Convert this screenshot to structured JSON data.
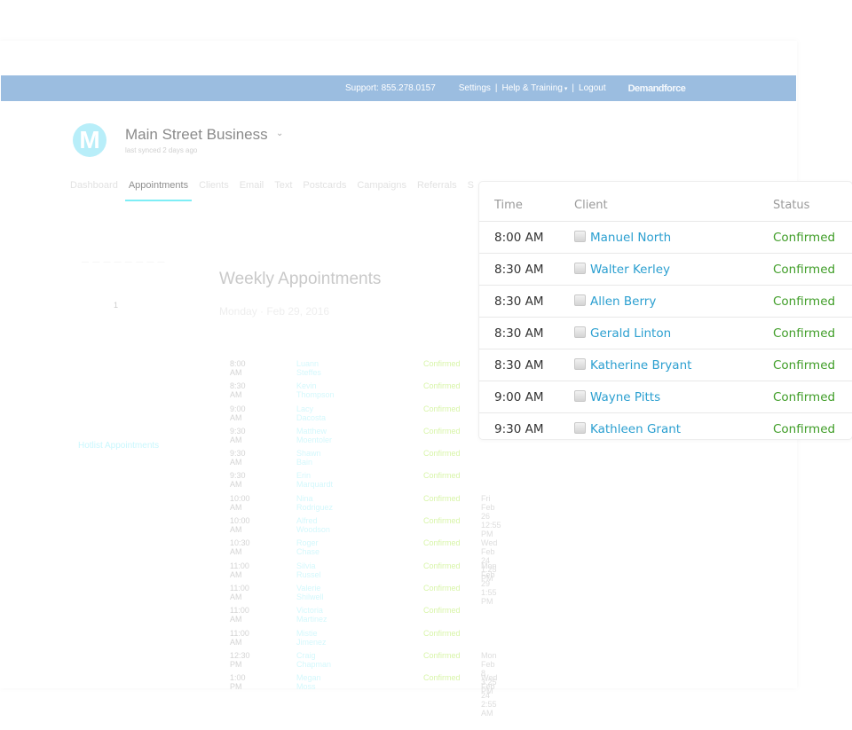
{
  "topbar": {
    "support": "Support:  855.278.0157",
    "settings": "Settings",
    "help": "Help & Training",
    "logout": "Logout",
    "brand": "Demandforce",
    "separator": "|",
    "caret": "▾",
    "color": "#9bbde0"
  },
  "business": {
    "logo_letter": "M",
    "name": "Main Street Business",
    "caret": "⌄",
    "synced": "last synced 2 days ago"
  },
  "nav": {
    "items": [
      "Dashboard",
      "Appointments",
      "Clients",
      "Email",
      "Text",
      "Postcards",
      "Campaigns",
      "Referrals",
      "S"
    ],
    "active": "Appointments"
  },
  "sidebar": {
    "label": "— — — — — — — —",
    "count": "1",
    "hotlist": "Hotlist Appointments"
  },
  "weekly": {
    "title": "Weekly Appointments",
    "date": "Monday · Feb 29, 2016",
    "rows": [
      {
        "time": "8:00 AM",
        "client": "Luann Steffes",
        "status": "Confirmed",
        "note": ""
      },
      {
        "time": "8:30 AM",
        "client": "Kevin Thompson",
        "status": "Confirmed",
        "note": ""
      },
      {
        "time": "9:00 AM",
        "client": "Lacy Dacosta",
        "status": "Confirmed",
        "note": ""
      },
      {
        "time": "9:30 AM",
        "client": "Matthew Moentoler",
        "status": "Confirmed",
        "note": ""
      },
      {
        "time": "9:30 AM",
        "client": "Shawn Bain",
        "status": "Confirmed",
        "note": ""
      },
      {
        "time": "9:30 AM",
        "client": "Erin Marquardt",
        "status": "Confirmed",
        "note": ""
      },
      {
        "time": "10:00 AM",
        "client": "Nina Rodriguez",
        "status": "Confirmed",
        "note": "Fri Feb 26 12:55 PM"
      },
      {
        "time": "10:00 AM",
        "client": "Alfred Woodson",
        "status": "Confirmed",
        "note": ""
      },
      {
        "time": "10:30 AM",
        "client": "Roger Chase",
        "status": "Confirmed",
        "note": "Wed Feb 24 1:25 PM"
      },
      {
        "time": "11:00 AM",
        "client": "Silvia Russel",
        "status": "Confirmed",
        "note": "Mon Feb 29 1:55 PM"
      },
      {
        "time": "11:00 AM",
        "client": "Valerie Shilwell",
        "status": "Confirmed",
        "note": ""
      },
      {
        "time": "11:00 AM",
        "client": "Victoria Martinez",
        "status": "Confirmed",
        "note": ""
      },
      {
        "time": "11:00 AM",
        "client": "Mistie Jimenez",
        "status": "Confirmed",
        "note": ""
      },
      {
        "time": "12:30 PM",
        "client": "Craig Chapman",
        "status": "Confirmed",
        "note": "Mon Feb 8 3:25 PM"
      },
      {
        "time": "1:00 PM",
        "client": "Megan Moss",
        "status": "Confirmed",
        "note": "Wed Feb 24 2:55 AM"
      }
    ]
  },
  "card": {
    "headers": {
      "time": "Time",
      "client": "Client",
      "status": "Status"
    },
    "rows": [
      {
        "time": "8:00 AM",
        "client": "Manuel North",
        "status": "Confirmed"
      },
      {
        "time": "8:30 AM",
        "client": "Walter Kerley",
        "status": "Confirmed"
      },
      {
        "time": "8:30 AM",
        "client": "Allen Berry",
        "status": "Confirmed"
      },
      {
        "time": "8:30 AM",
        "client": "Gerald Linton",
        "status": "Confirmed"
      },
      {
        "time": "8:30 AM",
        "client": "Katherine Bryant",
        "status": "Confirmed"
      },
      {
        "time": "9:00 AM",
        "client": "Wayne Pitts",
        "status": "Confirmed"
      },
      {
        "time": "9:30 AM",
        "client": "Kathleen Grant",
        "status": "Confirmed"
      }
    ],
    "client_color": "#2b9fd0",
    "status_color": "#3f9d27"
  }
}
